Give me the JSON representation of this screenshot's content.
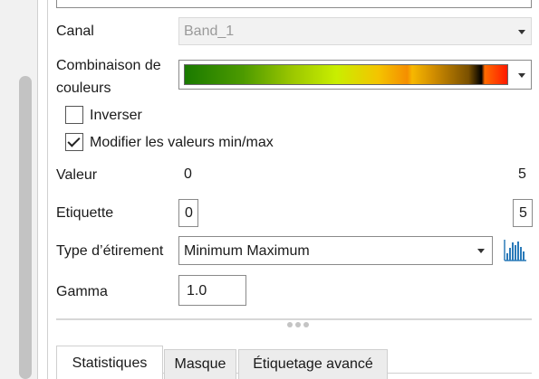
{
  "form": {
    "canal": {
      "label": "Canal",
      "value": "Band_1"
    },
    "combinaison": {
      "label_line1": "Combinaison de",
      "label_line2": "couleurs"
    },
    "inverser": {
      "label": "Inverser",
      "checked": false
    },
    "modifier": {
      "label": "Modifier les valeurs min/max",
      "checked": true
    },
    "valeur": {
      "label": "Valeur",
      "min": "0",
      "max": "5"
    },
    "etiquette": {
      "label": "Etiquette",
      "min": "0",
      "max": "5"
    },
    "type_etirement": {
      "label": "Type d’étirement",
      "value": "Minimum Maximum"
    },
    "gamma": {
      "label": "Gamma",
      "value": "1.0"
    }
  },
  "tabs": [
    {
      "label": "Statistiques",
      "active": true
    },
    {
      "label": "Masque",
      "active": false
    },
    {
      "label": "Étiquetage avancé",
      "active": false
    }
  ],
  "icons": {
    "dropdown": "chevron-down-icon",
    "histogram": "histogram-icon",
    "grip": "splitter-grip-icon"
  },
  "colors": {
    "accent": "#2a7ab9",
    "ramp": [
      "#1a7a00",
      "#9ac600",
      "#c9ee00",
      "#f4c400",
      "#f58e00",
      "#7a5000",
      "#000000",
      "#ff1a00"
    ]
  }
}
